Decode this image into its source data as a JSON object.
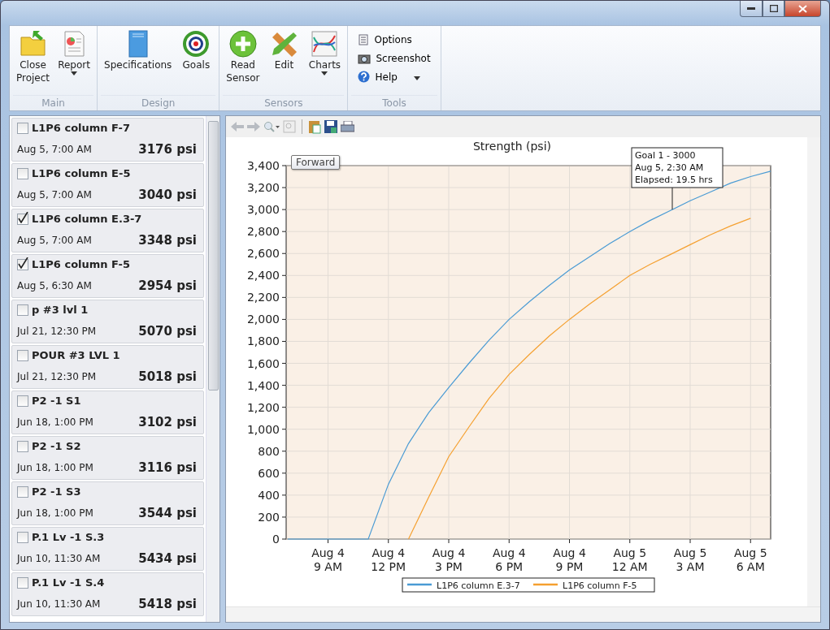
{
  "ribbon": {
    "groups": [
      {
        "label": "Main",
        "buttons": [
          {
            "kind": "folder",
            "label": "Close Project",
            "dropdown": false
          },
          {
            "kind": "report",
            "label": "Report",
            "dropdown": true
          }
        ]
      },
      {
        "label": "Design",
        "buttons": [
          {
            "kind": "book",
            "label": "Specifications",
            "dropdown": false
          },
          {
            "kind": "target",
            "label": "Goals",
            "dropdown": false
          }
        ]
      },
      {
        "label": "Sensors",
        "buttons": [
          {
            "kind": "plus",
            "label": "Read Sensor",
            "dropdown": false
          },
          {
            "kind": "pencil",
            "label": "Edit",
            "dropdown": false
          },
          {
            "kind": "chart",
            "label": "Charts",
            "dropdown": true
          }
        ]
      },
      {
        "label": "Tools",
        "small": [
          {
            "kind": "options",
            "label": "Options",
            "dropdown": false
          },
          {
            "kind": "camera",
            "label": "Screenshot",
            "dropdown": false
          },
          {
            "kind": "help",
            "label": "Help",
            "dropdown": true
          }
        ]
      }
    ]
  },
  "sensors": [
    {
      "name": "L1P6 column F-7",
      "time": "Aug 5, 7:00 AM",
      "reading": "3176 psi",
      "checked": false
    },
    {
      "name": "L1P6 column E-5",
      "time": "Aug 5, 7:00 AM",
      "reading": "3040 psi",
      "checked": false
    },
    {
      "name": "L1P6 column E.3-7",
      "time": "Aug 5, 7:00 AM",
      "reading": "3348 psi",
      "checked": true
    },
    {
      "name": "L1P6 column F-5",
      "time": "Aug 5, 6:30 AM",
      "reading": "2954 psi",
      "checked": true
    },
    {
      "name": "p #3 lvl 1",
      "time": "Jul 21, 12:30 PM",
      "reading": "5070 psi",
      "checked": false
    },
    {
      "name": "POUR #3 LVL 1",
      "time": "Jul 21, 12:30 PM",
      "reading": "5018 psi",
      "checked": false
    },
    {
      "name": "P2 -1 S1",
      "time": "Jun 18, 1:00 PM",
      "reading": "3102 psi",
      "checked": false
    },
    {
      "name": "P2 -1 S2",
      "time": "Jun 18, 1:00 PM",
      "reading": "3116 psi",
      "checked": false
    },
    {
      "name": "P2 -1 S3",
      "time": "Jun 18, 1:00 PM",
      "reading": "3544 psi",
      "checked": false
    },
    {
      "name": "P.1 Lv -1 S.3",
      "time": "Jun 10, 11:30 AM",
      "reading": "5434 psi",
      "checked": false
    },
    {
      "name": "P.1 Lv -1 S.4",
      "time": "Jun 10, 11:30 AM",
      "reading": "5418 psi",
      "checked": false
    }
  ],
  "chart_toolbar": {
    "tooltip": "Forward"
  },
  "chart": {
    "chart_data": {
      "type": "line",
      "title": "Strength (psi)",
      "categories": [
        null,
        null,
        "Aug 4\n9 AM",
        null,
        null,
        "Aug 4\n12 PM",
        null,
        null,
        "Aug 4\n3 PM",
        null,
        null,
        "Aug 4\n6 PM",
        null,
        null,
        "Aug 4\n9 PM",
        null,
        null,
        "Aug 5\n12 AM",
        null,
        null,
        "Aug 5\n3 AM",
        null,
        null,
        "Aug 5\n6 AM",
        null
      ],
      "series": [
        {
          "name": "L1P6 column E.3-7",
          "color": "#4a9bd4",
          "values": [
            0,
            0,
            0,
            0,
            0,
            500,
            870,
            1150,
            1380,
            1600,
            1810,
            2000,
            2160,
            2310,
            2450,
            2570,
            2690,
            2800,
            2900,
            2990,
            3080,
            3160,
            3240,
            3300,
            3350
          ]
        },
        {
          "name": "L1P6 column F-5",
          "color": "#f5a030",
          "values": [
            null,
            null,
            null,
            null,
            null,
            null,
            0,
            380,
            750,
            1020,
            1280,
            1500,
            1680,
            1850,
            2000,
            2140,
            2270,
            2400,
            2500,
            2590,
            2680,
            2770,
            2850,
            2920,
            null
          ]
        }
      ],
      "ylim": [
        0,
        3400
      ],
      "grid": true,
      "legend": true,
      "yticks": [
        {
          "value": 0,
          "label": "0"
        },
        {
          "value": 200,
          "label": "200"
        },
        {
          "value": 400,
          "label": "400"
        },
        {
          "value": 600,
          "label": "600"
        },
        {
          "value": 800,
          "label": "800"
        },
        {
          "value": 1000,
          "label": "1,000"
        },
        {
          "value": 1200,
          "label": "1,200"
        },
        {
          "value": 1400,
          "label": "1,400"
        },
        {
          "value": 1600,
          "label": "1,600"
        },
        {
          "value": 1800,
          "label": "1,800"
        },
        {
          "value": 2000,
          "label": "2,000"
        },
        {
          "value": 2200,
          "label": "2,200"
        },
        {
          "value": 2400,
          "label": "2,400"
        },
        {
          "value": 2600,
          "label": "2,600"
        },
        {
          "value": 2800,
          "label": "2,800"
        },
        {
          "value": 3000,
          "label": "3,000"
        },
        {
          "value": 3200,
          "label": "3,200"
        },
        {
          "value": 3400,
          "label": "3,400"
        }
      ],
      "annotations": [
        {
          "y": 3000,
          "text": "Goal 1 - 3000\nAug 5, 2:30 AM\nElapsed: 19.5 hrs"
        }
      ]
    }
  }
}
